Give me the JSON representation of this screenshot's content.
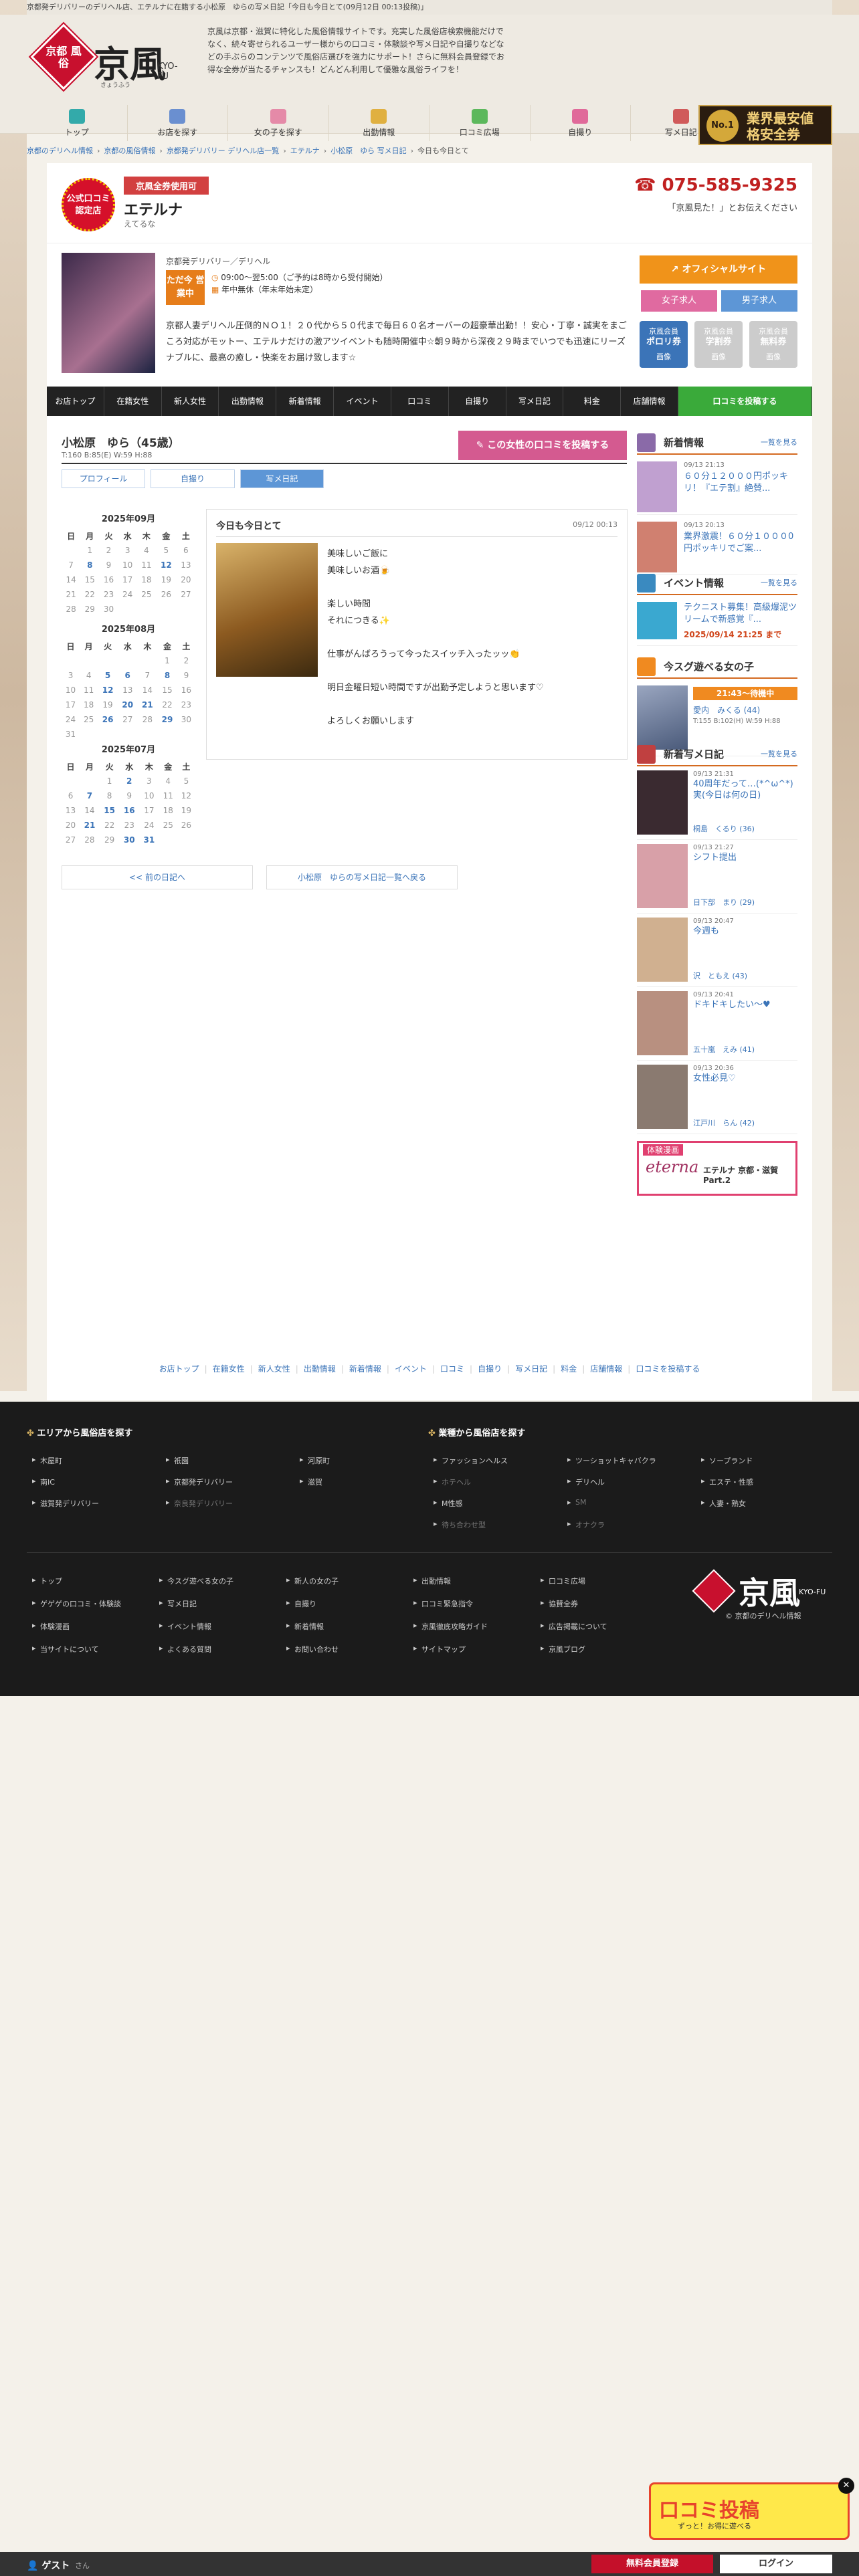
{
  "topline": "京都発デリバリーのデリヘル店、エテルナに在籍する小松原　ゆらの写メ日記「今日も今日とて(09月12日 00:13投稿)」",
  "header": {
    "logo_badge": "京都 風俗",
    "logo_big": "京風",
    "logo_small": "きょうふう",
    "logo_en": "KYO-FU",
    "intro": "京風は京都・滋賀に特化した風俗情報サイトです。充実した風俗店検索機能だけでなく、続々寄せられるユーザー様からの口コミ・体験談や写メ日記や自撮りなどなどの手ぶらのコンテンツで風俗店選びを強力にサポート！さらに無料会員登録でお得な全券が当たるチャンスも！どんどん利用して優雅な風俗ライフを！"
  },
  "gnav": [
    {
      "label": "トップ",
      "color": "#3aa"
    },
    {
      "label": "お店を探す",
      "color": "#6a8fd0"
    },
    {
      "label": "女の子を探す",
      "color": "#e58aa8"
    },
    {
      "label": "出勤情報",
      "color": "#e0b040"
    },
    {
      "label": "口コミ広場",
      "color": "#5cb85c"
    },
    {
      "label": "自撮り",
      "color": "#e06a9a"
    },
    {
      "label": "写メ日記",
      "color": "#d05a5a"
    },
    {
      "label": "口コミ緊急指令",
      "color": "#e0a040"
    }
  ],
  "nobanner": {
    "medal": "No.1",
    "l1": "業界最安値",
    "l2": "格安全券"
  },
  "breadcrumb": [
    "京都のデリヘル情報",
    "京都の風俗情報",
    "京都発デリバリー デリヘル店一覧",
    "エテルナ",
    "小松原　ゆら 写メ日記",
    "今日も今日とて"
  ],
  "shop": {
    "badge": "公式口コミ 認定店",
    "coupon": "京風全券使用可",
    "name": "エテルナ",
    "kana": "えてるな",
    "tel": "075-585-9325",
    "telnote": "「京風見た！」とお伝えください",
    "genre": "京都発デリバリー／デリヘル",
    "open": "ただ今 営業中",
    "hours": "09:00～翌5:00（ご予約は8時から受付開始）",
    "holiday": "年中無休（年末年始未定）",
    "desc": "京都人妻デリヘル圧倒的ＮＯ１！２０代から５０代まで毎日６０名オーバーの超豪華出勤！！安心・丁寧・誠実をまごころ対応がモットー、エテルナだけの激アツイベントも随時開催中☆朝９時から深夜２９時までいつでも迅速にリーズナブルに、最高の癒し・快楽をお届け致します☆",
    "offsite": "オフィシャルサイト",
    "req_girl": "女子求人",
    "req_man": "男子求人",
    "pts": [
      {
        "t": "京風会員",
        "b": "ポロリ券",
        "c": "#3b74b8",
        "s": "画像",
        "off": false
      },
      {
        "t": "京風会員",
        "b": "学割券",
        "c": "#cccccc",
        "s": "画像",
        "off": true
      },
      {
        "t": "京風会員",
        "b": "無料券",
        "c": "#cccccc",
        "s": "画像",
        "off": true
      }
    ]
  },
  "shopnav": [
    "お店トップ",
    "在籍女性",
    "新人女性",
    "出勤情報",
    "新着情報",
    "イベント",
    "口コミ",
    "自撮り",
    "写メ日記",
    "料金",
    "店舗情報",
    "口コミを投稿する"
  ],
  "girl": {
    "name": "小松原　ゆら（45歳）",
    "size": "T:160 B:85(E) W:59 H:88",
    "kuchi": "この女性の口コミを投稿する"
  },
  "tabs": [
    "プロフィール",
    "自撮り",
    "写メ日記"
  ],
  "cal": [
    {
      "title": "2025年09月",
      "rows": [
        [
          "",
          "1",
          "2",
          "3",
          "4",
          "5",
          "6"
        ],
        [
          "7",
          "8",
          "9",
          "10",
          "11",
          "12",
          "13"
        ],
        [
          "14",
          "15",
          "16",
          "17",
          "18",
          "19",
          "20"
        ],
        [
          "21",
          "22",
          "23",
          "24",
          "25",
          "26",
          "27"
        ],
        [
          "28",
          "29",
          "30",
          "",
          "",
          "",
          ""
        ]
      ],
      "links": [
        "8",
        "12"
      ]
    },
    {
      "title": "2025年08月",
      "rows": [
        [
          "",
          "",
          "",
          "",
          "",
          "1",
          "2"
        ],
        [
          "3",
          "4",
          "5",
          "6",
          "7",
          "8",
          "9"
        ],
        [
          "10",
          "11",
          "12",
          "13",
          "14",
          "15",
          "16"
        ],
        [
          "17",
          "18",
          "19",
          "20",
          "21",
          "22",
          "23"
        ],
        [
          "24",
          "25",
          "26",
          "27",
          "28",
          "29",
          "30"
        ],
        [
          "31",
          "",
          "",
          "",
          "",
          "",
          ""
        ]
      ],
      "links": [
        "5",
        "6",
        "8",
        "12",
        "20",
        "21",
        "26",
        "29"
      ]
    },
    {
      "title": "2025年07月",
      "rows": [
        [
          "",
          "",
          "1",
          "2",
          "3",
          "4",
          "5"
        ],
        [
          "6",
          "7",
          "8",
          "9",
          "10",
          "11",
          "12"
        ],
        [
          "13",
          "14",
          "15",
          "16",
          "17",
          "18",
          "19"
        ],
        [
          "20",
          "21",
          "22",
          "23",
          "24",
          "25",
          "26"
        ],
        [
          "27",
          "28",
          "29",
          "30",
          "31",
          "",
          ""
        ]
      ],
      "links": [
        "2",
        "7",
        "15",
        "16",
        "21",
        "30",
        "31"
      ]
    }
  ],
  "dow": [
    "日",
    "月",
    "火",
    "水",
    "木",
    "金",
    "土"
  ],
  "diary": {
    "title": "今日も今日とて",
    "date": "09/12 00:13",
    "lines": [
      "美味しいご飯に",
      "美味しいお酒🍺",
      "",
      "楽しい時間",
      "それにつきる✨",
      "",
      "仕事がんばろうって今ったスイッチ入ったッッ👏",
      "",
      "明日金曜日短い時間ですが出勤予定しようと思います♡",
      "",
      "よろしくお願いします"
    ]
  },
  "pager": {
    "prev": "<< 前の日記へ",
    "list": "小松原　ゆらの写メ日記一覧へ戻る"
  },
  "side": {
    "news_title": "新着情報",
    "more": "一覧を見る",
    "news": [
      {
        "d": "09/13 21:13",
        "t": "６０分１２０００円ポッキリ！『エテ割』絶賛..."
      },
      {
        "d": "09/13 20:13",
        "t": "業界激震！６０分１０００0円ポッキリでご案..."
      }
    ],
    "event_title": "イベント情報",
    "event": {
      "t": "テクニスト募集！高級爆泥ツリームで新感覚『...",
      "d": "2025/09/14 21:25 まで"
    },
    "now_title": "今スグ遊べる女の子",
    "now": {
      "time": "21:43～待機中",
      "name": "愛内　みくる (44)",
      "size": "T:155 B:102(H) W:59 H:88"
    },
    "diary_title": "新着写メ日記",
    "diaries": [
      {
        "d": "09/13 21:31",
        "t": "40周年だって…(*^ω^*)実(今日は何の日)",
        "n": "桐島　くるり (36)"
      },
      {
        "d": "09/13 21:27",
        "t": "シフト提出",
        "n": "日下部　まり (29)"
      },
      {
        "d": "09/13 20:47",
        "t": "今週も",
        "n": "沢　ともえ (43)"
      },
      {
        "d": "09/13 20:41",
        "t": "ドキドキしたい〜♥",
        "n": "五十嵐　えみ (41)"
      },
      {
        "d": "09/13 20:36",
        "t": "女性必見♡",
        "n": "江戸川　らん (42)"
      }
    ],
    "bottom_banner": {
      "t": "体験漫画",
      "e": "eterna",
      "s": "エテルナ 京都・滋賀 Part.2"
    }
  },
  "footnav": [
    "お店トップ",
    "在籍女性",
    "新人女性",
    "出勤情報",
    "新着情報",
    "イベント",
    "口コミ",
    "自撮り",
    "写メ日記",
    "料金",
    "店舗情報",
    "口コミを投稿する"
  ],
  "footer": {
    "area_title": "エリアから風俗店を探す",
    "genre_title": "業種から風俗店を探す",
    "area": [
      "木屋町",
      "祇園",
      "河原町",
      "南IC",
      "京都発デリバリー",
      "滋賀",
      "滋賀発デリバリー",
      "奈良発デリバリー"
    ],
    "genre": [
      "ファッションヘルス",
      "ソープランド",
      "ツーショットキャバクラ",
      "ホテヘル",
      "デリヘル",
      "エステ・性感",
      "M性感",
      "SM",
      "人妻・熟女",
      "待ち合わせ型",
      "オナクラ"
    ],
    "links": [
      "トップ",
      "今スグ遊べる女の子",
      "新人の女の子",
      "出勤情報",
      "口コミ広場",
      "ゲゲゲの口コミ・体験談",
      "写メ日記",
      "自撮り",
      "口コミ緊急指令",
      "協賛全券",
      "体験漫画",
      "イベント情報",
      "新着情報",
      "京風徹底攻略ガイド",
      "広告掲載について",
      "当サイトについて",
      "よくある質問",
      "お問い合わせ",
      "サイトマップ",
      "京風ブログ"
    ],
    "copy": "© 京都のデリヘル情報"
  },
  "guest": {
    "g": "ゲスト",
    "suffix": "さん",
    "reg": "無料会員登録",
    "login": "ログイン"
  },
  "kuchi_banner": {
    "t": "口コミ投稿",
    "s": "ずっと！お得に遊べる"
  }
}
